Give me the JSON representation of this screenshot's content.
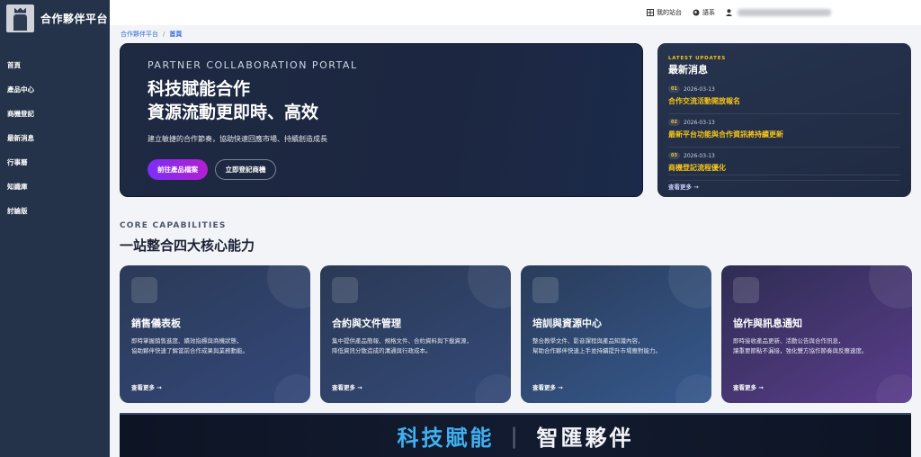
{
  "brand": {
    "name": "合作夥伴平台"
  },
  "sidebar": {
    "items": [
      {
        "label": "首頁"
      },
      {
        "label": "產品中心"
      },
      {
        "label": "商機登記"
      },
      {
        "label": "最新消息"
      },
      {
        "label": "行事曆"
      },
      {
        "label": "知識庫"
      },
      {
        "label": "討論版"
      }
    ]
  },
  "topbar": {
    "my_site": "我的站台",
    "language": "語系"
  },
  "breadcrumb": {
    "root": "合作夥伴平台",
    "current": "首頁"
  },
  "hero": {
    "eyebrow": "PARTNER COLLABORATION PORTAL",
    "title_line1": "科技賦能合作",
    "title_line2": "資源流動更即時、高效",
    "description": "建立敏捷的合作節奏，協助快速回應市場、持續創造成長",
    "primary_button": "前往產品檔案",
    "secondary_button": "立即登記商機"
  },
  "updates": {
    "eyebrow": "LATEST UPDATES",
    "title": "最新消息",
    "items": [
      {
        "num": "01",
        "date": "2026-03-13",
        "title": "合作交流活動開放報名"
      },
      {
        "num": "02",
        "date": "2026-03-13",
        "title": "最新平台功能與合作資訊將持續更新"
      },
      {
        "num": "03",
        "date": "2026-03-13",
        "title": "商機登記流程優化"
      }
    ],
    "more": "查看更多 →"
  },
  "capabilities": {
    "eyebrow": "CORE CAPABILITIES",
    "title": "一站整合四大核心能力",
    "cards": [
      {
        "title": "銷售儀表板",
        "desc1": "即時掌握銷售進度、績效指標與商機狀態，",
        "desc2": "協助夥伴快速了解當前合作成果與業務動能。",
        "more": "查看更多 →"
      },
      {
        "title": "合約與文件管理",
        "desc1": "集中提供產品簡報、規格文件、合約資料與下載資源，",
        "desc2": "降低資訊分散造成的溝通與行政成本。",
        "more": "查看更多 →"
      },
      {
        "title": "培訓與資源中心",
        "desc1": "整合教學文件、影音課程與產品知識內容，",
        "desc2": "幫助合作夥伴快速上手並持續提升市場應對能力。",
        "more": "查看更多 →"
      },
      {
        "title": "協作與訊息通知",
        "desc1": "即時接收產品更新、活動公告與合作訊息，",
        "desc2": "讓重要節點不漏接，強化雙方協作節奏與反應速度。",
        "more": "查看更多 →"
      }
    ]
  },
  "banner": {
    "left": "科技賦能",
    "separator": "|",
    "right": "智匯夥伴"
  },
  "colors": {
    "sidebar": "#243349",
    "accent_yellow": "#f5c518",
    "accent_blue": "#3fb0f0",
    "primary_purple": "#7b2ff7"
  }
}
